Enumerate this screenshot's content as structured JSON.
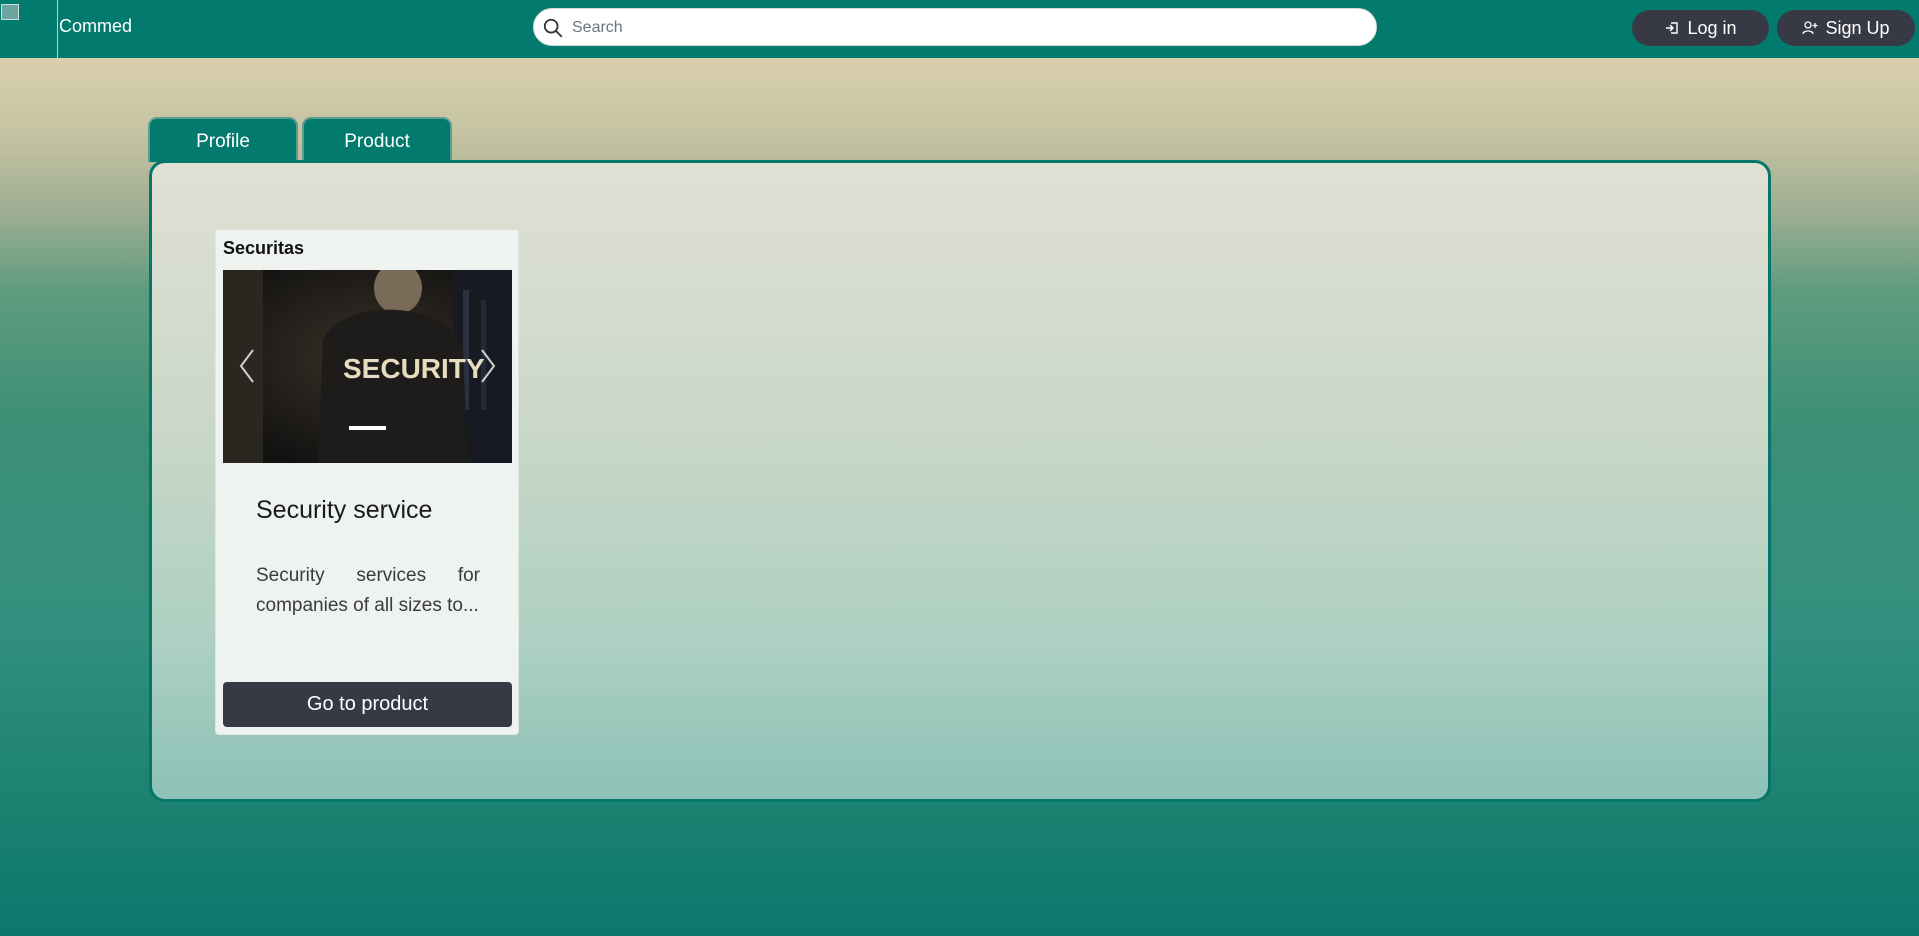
{
  "header": {
    "brand": "Commed",
    "search_placeholder": "Search",
    "login_label": "Log in",
    "signup_label": "Sign Up"
  },
  "tabs": [
    {
      "label": "Profile"
    },
    {
      "label": "Product"
    }
  ],
  "products": [
    {
      "company": "Securitas",
      "image_text": "SECURITY",
      "title": "Security service",
      "description": "Security services for companies of all sizes to...",
      "button_label": "Go to product"
    }
  ],
  "colors": {
    "topbar": "#037a6e",
    "dark_button": "#373944",
    "panel_border": "#07766a"
  },
  "icons": {
    "search": "search-icon",
    "login": "login-icon",
    "signup": "add-user-icon",
    "prev": "chevron-left-icon",
    "next": "chevron-right-icon"
  }
}
